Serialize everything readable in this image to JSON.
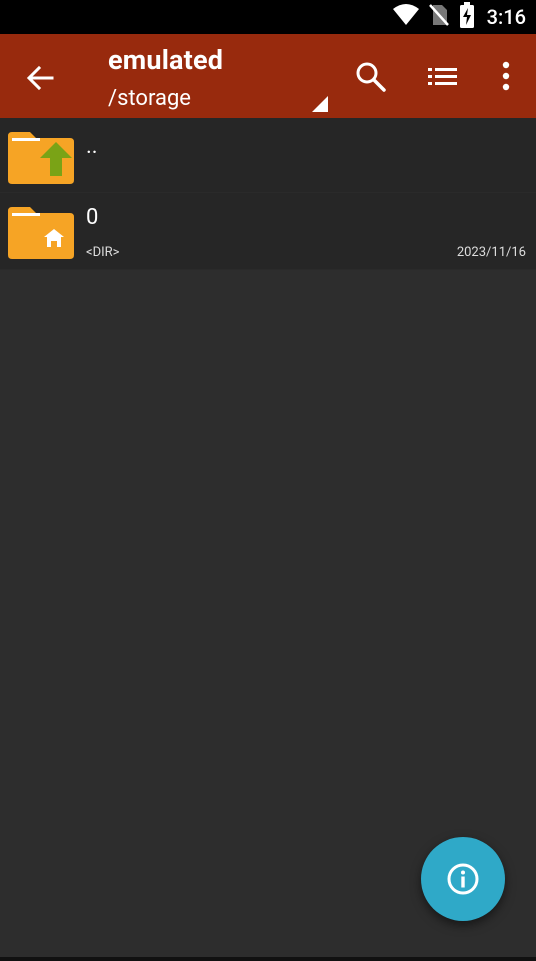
{
  "status": {
    "time": "3:16"
  },
  "appbar": {
    "title": "emulated",
    "subtitle": "/storage"
  },
  "files": [
    {
      "name": "..",
      "type": "parent-folder"
    },
    {
      "name": "0",
      "kind": "<DIR>",
      "date": "2023/11/16",
      "type": "home-folder"
    }
  ],
  "colors": {
    "appbar": "#982a0d",
    "background": "#2d2d2d",
    "row": "#262626",
    "fab": "#2fa9c8",
    "folder": "#f6a425",
    "arrow": "#7aa316"
  },
  "icons": [
    "back-arrow-icon",
    "search-icon",
    "list-view-icon",
    "more-vert-icon",
    "info-icon",
    "wifi-icon",
    "no-sim-icon",
    "battery-icon"
  ]
}
